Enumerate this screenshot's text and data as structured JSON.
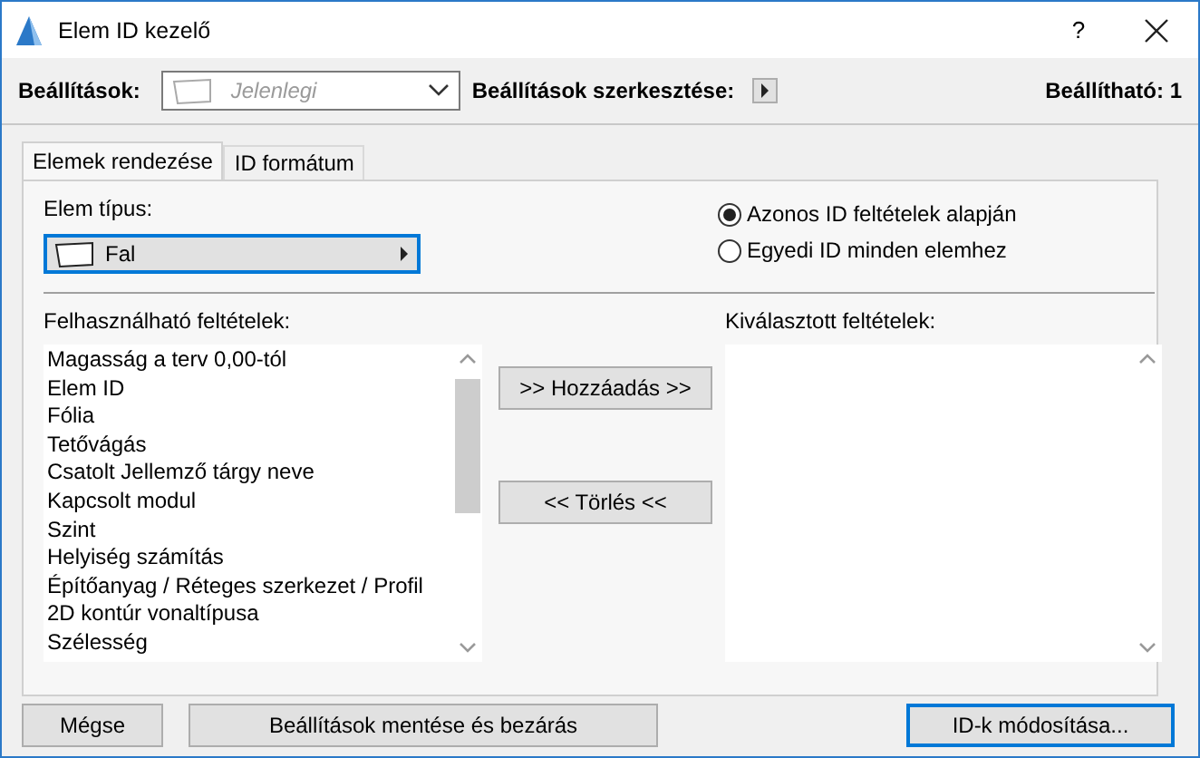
{
  "window": {
    "title": "Elem ID kezelő",
    "help": "?"
  },
  "toolbar": {
    "settings_label": "Beállítások:",
    "settings_dropdown": {
      "value": "Jelenlegi",
      "disabled": true
    },
    "edit_label": "Beállítások szerkesztése:",
    "editable_count": "Beállítható: 1"
  },
  "tabs": [
    {
      "label": "Elemek rendezése",
      "selected": true
    },
    {
      "label": "ID formátum",
      "selected": false
    }
  ],
  "element_type": {
    "label": "Elem típus:",
    "value": "Fal"
  },
  "radios": [
    {
      "label": "Azonos ID feltételek alapján",
      "selected": true
    },
    {
      "label": "Egyedi ID minden elemhez",
      "selected": false
    }
  ],
  "available": {
    "label": "Felhasználható feltételek:",
    "items": [
      "Magasság a terv 0,00-tól",
      "Elem ID",
      "Fólia",
      "Tetővágás",
      "Csatolt Jellemző tárgy neve",
      "Kapcsolt modul",
      "Szint",
      "Helyiség számítás",
      "Építőanyag / Réteges szerkezet / Profil",
      "2D kontúr vonaltípusa",
      "Szélesség"
    ]
  },
  "actions": [
    ">> Hozzáadás >>",
    "<< Törlés <<"
  ],
  "selected_criteria": {
    "label": "Kiválasztott feltételek:"
  },
  "footer_buttons": [
    {
      "label": "Mégse",
      "default": false
    },
    {
      "label": "Beállítások mentése és bezárás",
      "default": false
    },
    {
      "label": "ID-k módosítása...",
      "default": true
    }
  ]
}
